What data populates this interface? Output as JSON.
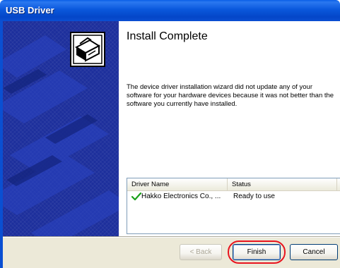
{
  "window": {
    "title": "USB Driver"
  },
  "main": {
    "heading": "Install Complete",
    "description": "The device driver installation wizard did not update any of your software for your hardware devices because it was not better than the software you currently have installed."
  },
  "driver_list": {
    "columns": [
      "Driver Name",
      "Status"
    ],
    "rows": [
      {
        "name": "Hakko Electronics Co., ...",
        "status": "Ready to use",
        "icon": "checkmark-icon"
      }
    ]
  },
  "buttons": {
    "back_label": "< Back",
    "finish_label": "Finish",
    "cancel_label": "Cancel"
  },
  "colors": {
    "title_bar": "#0a58dc",
    "side_panel": "#1d2f9c",
    "highlight_ring": "#e8141e",
    "check": "#1aa01a"
  },
  "icons": {
    "wizard": "installer-box-icon",
    "row_status": "checkmark-icon"
  }
}
